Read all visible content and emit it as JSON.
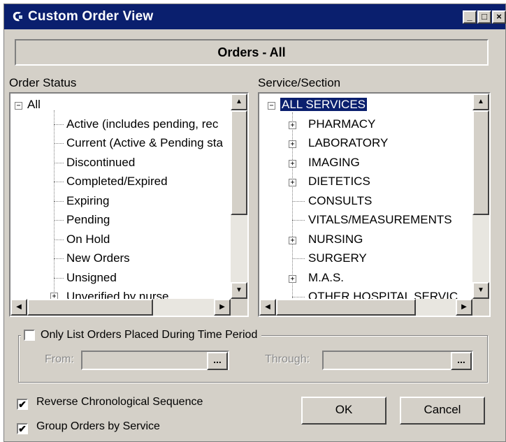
{
  "window": {
    "title": "Custom Order View",
    "minimize_glyph": "_",
    "maximize_glyph": "□",
    "close_glyph": "×"
  },
  "banner": "Orders - All",
  "order_status": {
    "label": "Order Status",
    "root": "All",
    "items": [
      "Active (includes pending, rec",
      "Current (Active & Pending sta",
      "Discontinued",
      "Completed/Expired",
      "Expiring",
      "Pending",
      "On Hold",
      "New Orders",
      "Unsigned",
      "Unverified by nurse"
    ]
  },
  "service_section": {
    "label": "Service/Section",
    "root": "ALL SERVICES",
    "items": [
      {
        "label": "PHARMACY",
        "expandable": true
      },
      {
        "label": "LABORATORY",
        "expandable": true
      },
      {
        "label": "IMAGING",
        "expandable": true
      },
      {
        "label": "DIETETICS",
        "expandable": true
      },
      {
        "label": "CONSULTS",
        "expandable": false
      },
      {
        "label": "VITALS/MEASUREMENTS",
        "expandable": false
      },
      {
        "label": "NURSING",
        "expandable": true
      },
      {
        "label": "SURGERY",
        "expandable": false
      },
      {
        "label": "M.A.S.",
        "expandable": true
      },
      {
        "label": "OTHER HOSPITAL SERVIC",
        "expandable": false
      }
    ]
  },
  "time_period": {
    "label": "Only List Orders Placed During Time Period",
    "checked": false,
    "from_label": "From:",
    "through_label": "Through:",
    "from_value": "",
    "through_value": "",
    "browse_label": "..."
  },
  "options": {
    "reverse_label": "Reverse Chronological Sequence",
    "reverse_checked": true,
    "group_label": "Group Orders by Service",
    "group_checked": true
  },
  "buttons": {
    "ok": "OK",
    "cancel": "Cancel"
  },
  "icons": {
    "title": "app-icon",
    "check": "✔"
  }
}
